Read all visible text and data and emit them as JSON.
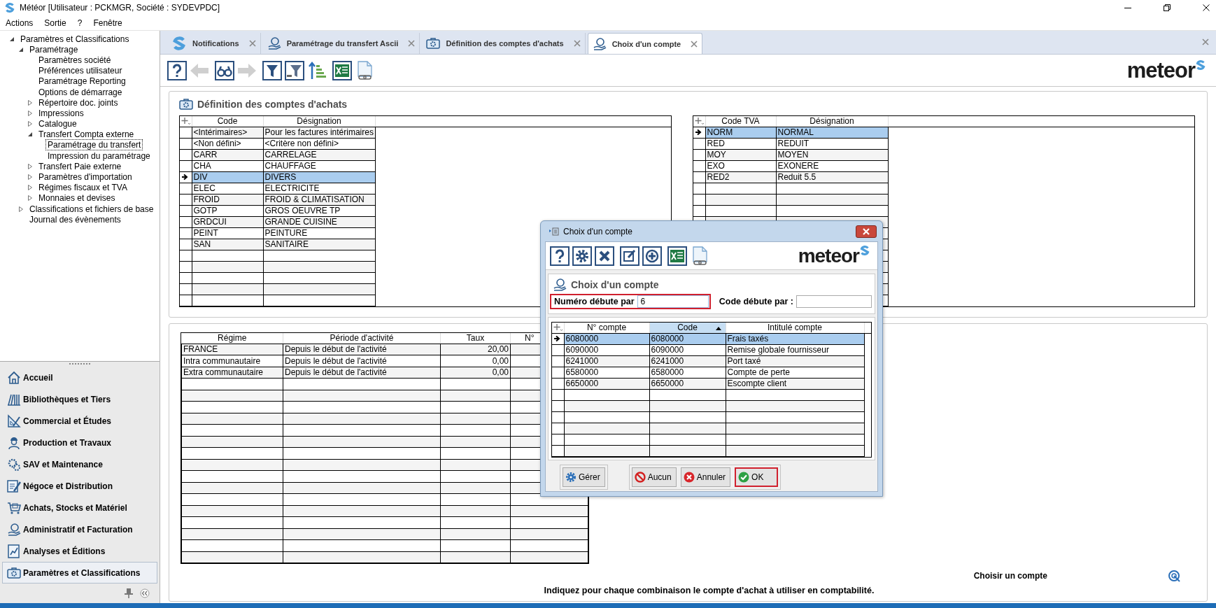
{
  "window": {
    "title": "Météor [Utilisateur : PCKMGR, Société : SYDEVPDC]"
  },
  "menu": [
    "Actions",
    "Sortie",
    "?",
    "Fenêtre"
  ],
  "tree": [
    {
      "label": "Paramètres et Classifications",
      "expanded": true,
      "selected": false,
      "children": [
        {
          "label": "Paramétrage",
          "expanded": true,
          "selected": false,
          "children": [
            {
              "label": "Paramètres société",
              "selected": false
            },
            {
              "label": "Préférences utilisateur",
              "selected": false
            },
            {
              "label": "Paramétrage Reporting",
              "selected": false
            },
            {
              "label": "Options de démarrage",
              "selected": false
            },
            {
              "label": "Répertoire doc. joints",
              "expanded": false,
              "selected": false
            },
            {
              "label": "Impressions",
              "expanded": false,
              "selected": false
            },
            {
              "label": "Catalogue",
              "expanded": false,
              "selected": false
            },
            {
              "label": "Transfert Compta externe",
              "expanded": true,
              "selected": false,
              "children": [
                {
                  "label": "Paramétrage du transfert",
                  "selected": true
                },
                {
                  "label": "Impression du paramétrage",
                  "selected": false
                }
              ]
            },
            {
              "label": "Transfert Paie externe",
              "expanded": false,
              "selected": false
            },
            {
              "label": "Paramètres d'importation",
              "expanded": false,
              "selected": false
            },
            {
              "label": "Régimes fiscaux et TVA",
              "expanded": false,
              "selected": false
            },
            {
              "label": "Monnaies et devises",
              "expanded": false,
              "selected": false
            }
          ]
        },
        {
          "label": "Classifications et fichiers de base",
          "expanded": false,
          "selected": false
        },
        {
          "label": "Journal des évènements",
          "selected": false
        }
      ]
    }
  ],
  "nav": [
    {
      "label": "Accueil",
      "selected": false
    },
    {
      "label": "Bibliothèques et Tiers",
      "selected": false
    },
    {
      "label": "Commercial et Études",
      "selected": false
    },
    {
      "label": "Production et Travaux",
      "selected": false
    },
    {
      "label": "SAV et Maintenance",
      "selected": false
    },
    {
      "label": "Négoce et Distribution",
      "selected": false
    },
    {
      "label": "Achats, Stocks et Matériel",
      "selected": false
    },
    {
      "label": "Administratif et Facturation",
      "selected": false
    },
    {
      "label": "Analyses et Éditions",
      "selected": false
    },
    {
      "label": "Paramètres et Classifications",
      "selected": true
    }
  ],
  "tabs": [
    {
      "label": "Notifications",
      "selected": false
    },
    {
      "label": "Paramétrage du transfert Ascii",
      "selected": false
    },
    {
      "label": "Définition des comptes d'achats",
      "selected": false
    },
    {
      "label": "Choix d'un compte",
      "selected": true
    }
  ],
  "toolbar": [
    {
      "kind": "help",
      "disabled": false
    },
    {
      "kind": "back",
      "disabled": true
    },
    {
      "kind": "find",
      "disabled": false
    },
    {
      "kind": "forward",
      "disabled": true
    },
    {
      "kind": "filter",
      "disabled": false
    },
    {
      "kind": "clear_filter",
      "disabled": false
    },
    {
      "kind": "sort",
      "disabled": false
    },
    {
      "kind": "excel",
      "disabled": false
    },
    {
      "kind": "link",
      "disabled": false
    }
  ],
  "logo": "meteor",
  "purchase_accounts": {
    "title": "Définition des comptes d'achats",
    "codes": {
      "columns": [
        "Code",
        "Désignation"
      ],
      "rows": [
        {
          "cells": [
            "<Intérimaires>",
            "Pour les factures intérimaires"
          ],
          "selected": false
        },
        {
          "cells": [
            "<Non défini>",
            "<Critère non défini>"
          ],
          "selected": false
        },
        {
          "cells": [
            "CARR",
            "CARRELAGE"
          ],
          "selected": false
        },
        {
          "cells": [
            "CHA",
            "CHAUFFAGE"
          ],
          "selected": false
        },
        {
          "cells": [
            "DIV",
            "DIVERS"
          ],
          "selected": true
        },
        {
          "cells": [
            "ELEC",
            "ELECTRICITE"
          ],
          "selected": false
        },
        {
          "cells": [
            "FROID",
            "FROID & CLIMATISATION"
          ],
          "selected": false
        },
        {
          "cells": [
            "GOTP",
            "GROS OEUVRE TP"
          ],
          "selected": false
        },
        {
          "cells": [
            "GRDCUI",
            "GRANDE CUISINE"
          ],
          "selected": false
        },
        {
          "cells": [
            "PEINT",
            "PEINTURE"
          ],
          "selected": false
        },
        {
          "cells": [
            "SAN",
            "SANITAIRE"
          ],
          "selected": false
        }
      ]
    },
    "vat_codes": {
      "columns": [
        "Code TVA",
        "Désignation"
      ],
      "rows": [
        {
          "cells": [
            "NORM",
            "NORMAL"
          ],
          "selected": true
        },
        {
          "cells": [
            "RED",
            "REDUIT"
          ],
          "selected": false
        },
        {
          "cells": [
            "MOY",
            "MOYEN"
          ],
          "selected": false
        },
        {
          "cells": [
            "EXO",
            "EXONERE"
          ],
          "selected": false
        },
        {
          "cells": [
            "RED2",
            "Reduit 5.5"
          ],
          "selected": false
        }
      ]
    }
  },
  "regimes": {
    "columns": [
      "Régime",
      "Période d'activité",
      "Taux",
      "N°"
    ],
    "rows": [
      {
        "cells": [
          "FRANCE",
          "Depuis le début de l'activité",
          "20,00"
        ]
      },
      {
        "cells": [
          "Intra communautaire",
          "Depuis le début de l'activité",
          "0,00"
        ]
      },
      {
        "cells": [
          "Extra communautaire",
          "Depuis le début de l'activité",
          "0,00"
        ]
      }
    ]
  },
  "hint": "Choisir un compte",
  "footer": "Indiquez pour chaque combinaison le compte d'achat à utiliser en comptabilité.",
  "dialog": {
    "title": "Choix d'un compte",
    "toolbar": [
      {
        "kind": "help",
        "disabled": false
      },
      {
        "kind": "settings",
        "disabled": false
      },
      {
        "kind": "delete",
        "disabled": false
      },
      {
        "kind": "edit",
        "disabled": false
      },
      {
        "kind": "add",
        "disabled": false
      },
      {
        "kind": "excel",
        "disabled": false
      },
      {
        "kind": "link",
        "disabled": false
      }
    ],
    "logo": "meteor",
    "heading": "Choix d'un compte",
    "filters": [
      {
        "label": "Numéro débute par",
        "value": "6",
        "highlighted": true
      },
      {
        "label": "Code débute par :",
        "highlighted": false
      }
    ],
    "table": {
      "columns": [
        {
          "label": "N° compte",
          "sorted": false
        },
        {
          "label": "Code",
          "sorted": true
        },
        {
          "label": "Intitulé compte",
          "sorted": false
        }
      ],
      "rows": [
        {
          "cells": [
            "6080000",
            "6080000",
            "Frais taxés"
          ],
          "selected": true
        },
        {
          "cells": [
            "6090000",
            "6090000",
            "Remise globale fournisseur"
          ],
          "selected": false
        },
        {
          "cells": [
            "6241000",
            "6241000",
            "Port taxé"
          ],
          "selected": false
        },
        {
          "cells": [
            "6580000",
            "6580000",
            "Compte de perte"
          ],
          "selected": false
        },
        {
          "cells": [
            "6650000",
            "6650000",
            "Escompte client"
          ],
          "selected": false
        }
      ]
    },
    "button_groups": [
      [
        {
          "label": "Gérer",
          "kind": "manage",
          "highlighted": false
        }
      ],
      [
        {
          "label": "Aucun",
          "kind": "none",
          "highlighted": false
        },
        {
          "label": "Annuler",
          "kind": "cancel",
          "highlighted": false
        },
        {
          "label": "OK",
          "kind": "ok",
          "highlighted": true
        }
      ]
    ]
  }
}
